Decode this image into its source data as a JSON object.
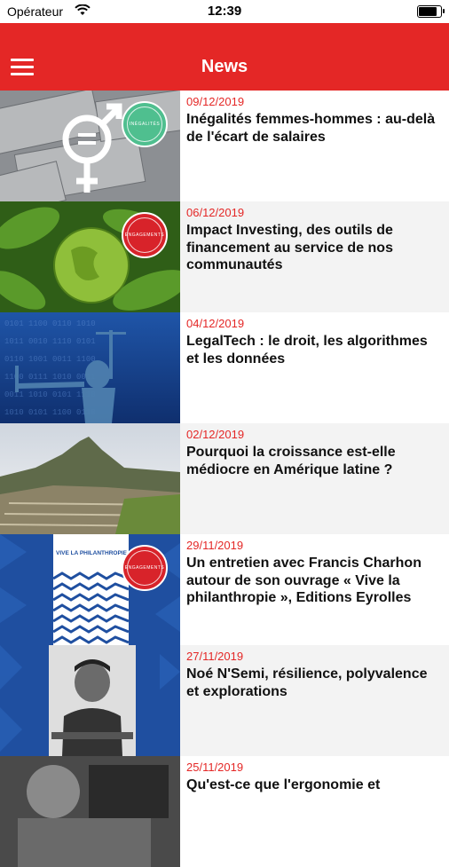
{
  "status": {
    "carrier": "Opérateur",
    "time": "12:39"
  },
  "header": {
    "title": "News"
  },
  "articles": [
    {
      "date": "09/12/2019",
      "title": "Inégalités femmes-hommes : au-delà de l'écart de salaires",
      "badge": "INÉGALITÉS",
      "badge_color": "#4fbf8f"
    },
    {
      "date": "06/12/2019",
      "title": "Impact Investing, des outils de financement au service de nos communautés",
      "badge": "ENGAGEMENTS",
      "badge_color": "#d8232a"
    },
    {
      "date": "04/12/2019",
      "title": "LegalTech : le droit, les algorithmes et les données"
    },
    {
      "date": "02/12/2019",
      "title": "Pourquoi la croissance est-elle médiocre en Amérique latine ?"
    },
    {
      "date": "29/11/2019",
      "title": "Un entretien avec Francis Charhon autour de son ouvrage « Vive la philanthropie », Editions Eyrolles",
      "badge": "ENGAGEMENTS",
      "badge_color": "#d8232a",
      "book_title": "VIVE LA PHILANTHROPIE"
    },
    {
      "date": "27/11/2019",
      "title": "Noé N'Semi, résilience, polyvalence et explorations"
    },
    {
      "date": "25/11/2019",
      "title": "Qu'est-ce que l'ergonomie et"
    }
  ],
  "colors": {
    "accent": "#e42726"
  }
}
